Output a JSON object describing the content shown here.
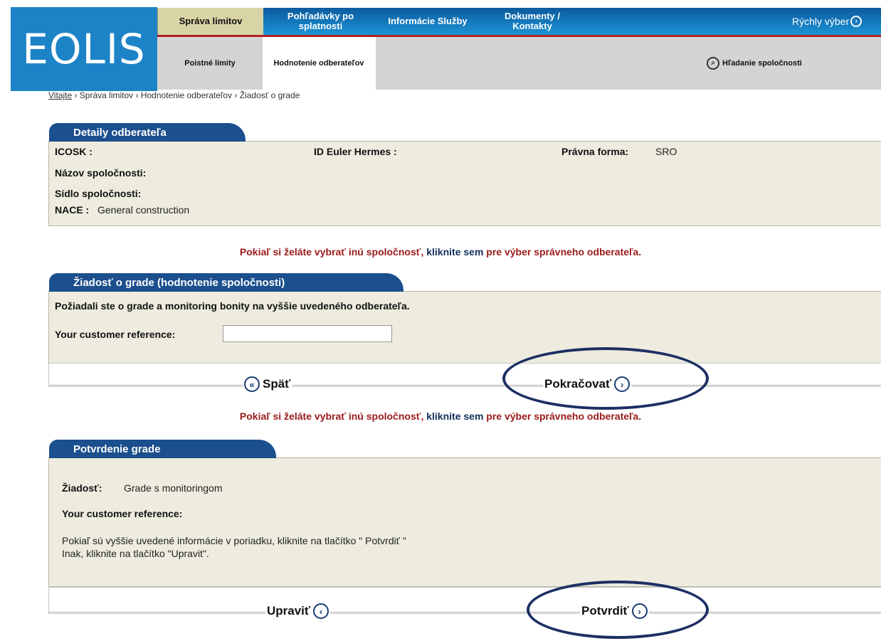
{
  "logo": {
    "text": "EOLIS"
  },
  "nav": {
    "tabs": [
      "Správa limitov",
      "Pohľadávky po splatnosti",
      "Informácie Služby",
      "Dokumenty / Kontakty"
    ],
    "quick": "Rýchly výber",
    "subtabs": [
      "Poistné limity",
      "Hodnotenie odberateľov"
    ],
    "company_search": "Hľadanie spoločnosti"
  },
  "breadcrumb": {
    "home": "Vitajte",
    "rest": " › Správa limitov › Hodnotenie odberateľov › Žiadosť o grade"
  },
  "details": {
    "title": "Detaily odberateľa",
    "icosk_label": "ICOSK :",
    "euler_label": "ID Euler Hermes :",
    "legal_label": "Právna forma:",
    "legal_value": "SRO",
    "name_label": "Názov spoločnosti:",
    "seat_label": "Sídlo spoločnosti:",
    "nace_label": "NACE :",
    "nace_value": "General construction"
  },
  "notice": {
    "part1": "Pokiaľ si želáte vybrať inú spoločnosť, ",
    "link": "kliknite sem",
    "part2": " pre výber správneho odberateľa."
  },
  "request": {
    "title": "Žiadosť o grade (hodnotenie spoločnosti)",
    "text": "Požiadali ste o grade a monitoring bonity na vyššie uvedeného odberateľa.",
    "ref_label": "Your customer reference:",
    "ref_value": "",
    "back": "Späť",
    "continue": "Pokračovať"
  },
  "confirm": {
    "title": "Potvrdenie grade",
    "request_label": "Žiadosť:",
    "request_value": "Grade s monitoringom",
    "ref_label": "Your customer reference:",
    "info1": "Pokiaľ sú vyššie uvedené informácie v poriadku, kliknite na tlačítko \" Potvrdiť \"",
    "info2": "Inak, kliknite na tlačítko \"Upravit\".",
    "edit": "Upraviť",
    "confirm": "Potvrdiť"
  },
  "colors": {
    "brand_blue": "#1c84c6",
    "tab_gold": "#d8d4a6",
    "panel_bg": "#edecdf",
    "header_navy": "#1b4f8e",
    "notice_red": "#9b1a1a",
    "annotation_navy": "#1d2f63"
  }
}
